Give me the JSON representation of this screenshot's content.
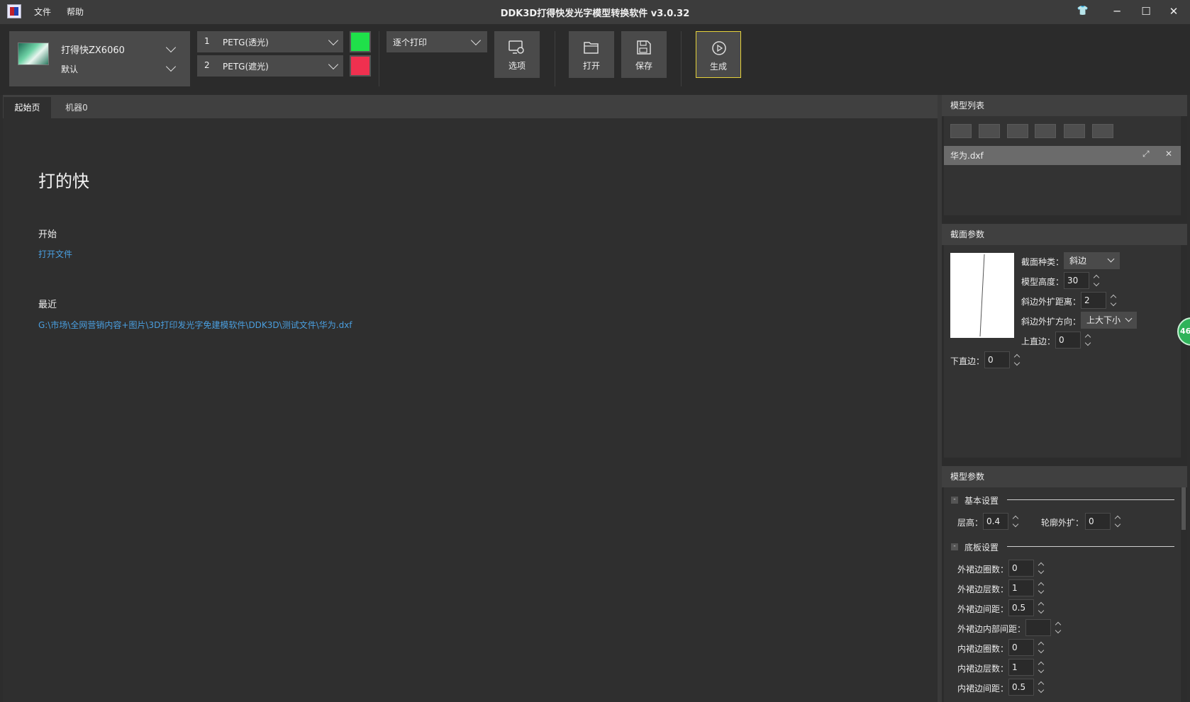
{
  "titlebar": {
    "title": "DDK3D打得快发光字模型转换软件 v3.0.32",
    "menu": [
      "文件",
      "帮助"
    ]
  },
  "toolbar": {
    "printer_name": "打得快ZX6060",
    "printer_profile": "默认",
    "materials": [
      {
        "index": "1",
        "name": "PETG(透光)",
        "color": "#1fe04a"
      },
      {
        "index": "2",
        "name": "PETG(遮光)",
        "color": "#f0304f"
      }
    ],
    "print_mode": "逐个打印",
    "buttons": {
      "options": "选项",
      "open": "打开",
      "save": "保存",
      "generate": "生成"
    }
  },
  "tabs": [
    "起始页",
    "机器0"
  ],
  "start_page": {
    "heading": "打的快",
    "start_label": "开始",
    "open_file": "打开文件",
    "recent_label": "最近",
    "recent_files": [
      "G:\\市场\\全网营销内容+图片\\3D打印发光字免建模软件\\DDK3D\\测试文件\\华为.dxf"
    ]
  },
  "model_list": {
    "title": "模型列表",
    "items": [
      "华为.dxf"
    ]
  },
  "section_params": {
    "title": "截面参数",
    "section_type_label": "截面种类：",
    "section_type_value": "斜边",
    "model_height_label": "模型高度：",
    "model_height_value": "30",
    "bevel_distance_label": "斜边外扩距离：",
    "bevel_distance_value": "2",
    "bevel_direction_label": "斜边外扩方向：",
    "bevel_direction_value": "上大下小",
    "top_straight_label": "上直边：",
    "top_straight_value": "0",
    "bottom_straight_label": "下直边：",
    "bottom_straight_value": "0"
  },
  "model_params": {
    "title": "模型参数",
    "basic_group": "基本设置",
    "layer_height_label": "层高：",
    "layer_height_value": "0.4",
    "contour_offset_label": "轮廓外扩：",
    "contour_offset_value": "0",
    "base_group": "底板设置",
    "rows": [
      {
        "label": "外裙边圈数：",
        "value": "0"
      },
      {
        "label": "外裙边层数：",
        "value": "1"
      },
      {
        "label": "外裙边间距：",
        "value": "0.5"
      },
      {
        "label": "外裙边内部间距：",
        "value": ""
      },
      {
        "label": "内裙边圈数：",
        "value": "0"
      },
      {
        "label": "内裙边层数：",
        "value": "1"
      },
      {
        "label": "内裙边间距：",
        "value": "0.5"
      }
    ]
  },
  "side_badge": "46",
  "colors": {
    "accent_link": "#4a9fe0",
    "generate_border": "#e6d23a",
    "badge": "#2fb35a"
  }
}
